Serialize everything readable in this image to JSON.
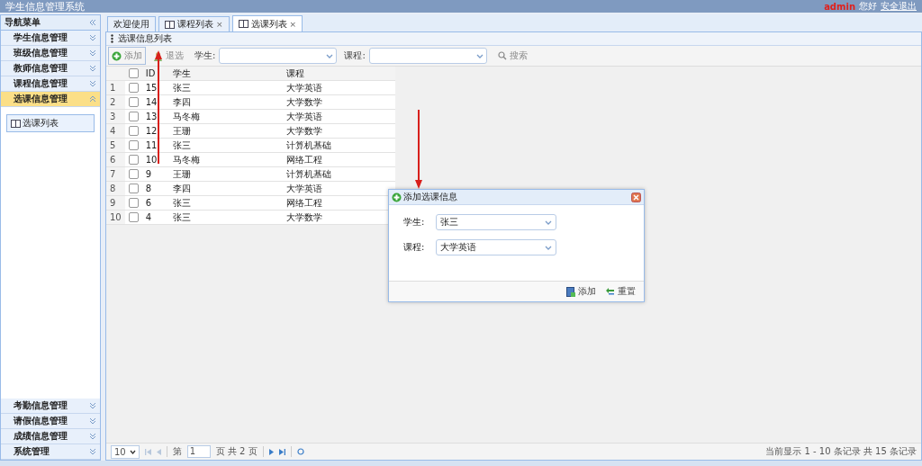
{
  "header": {
    "title": "学生信息管理系统",
    "user": "admin",
    "greeting": "您好",
    "logout": "安全退出"
  },
  "sidebar": {
    "title": "导航菜单",
    "items": [
      {
        "label": "学生信息管理",
        "selected": false,
        "expanded": false
      },
      {
        "label": "班级信息管理",
        "selected": false,
        "expanded": false
      },
      {
        "label": "教师信息管理",
        "selected": false,
        "expanded": false
      },
      {
        "label": "课程信息管理",
        "selected": false,
        "expanded": false
      },
      {
        "label": "选课信息管理",
        "selected": true,
        "expanded": true,
        "children": [
          {
            "label": "选课列表"
          }
        ]
      }
    ],
    "bottom_items": [
      {
        "label": "考勤信息管理",
        "selected": false,
        "expanded": false
      },
      {
        "label": "请假信息管理",
        "selected": false,
        "expanded": false
      },
      {
        "label": "成绩信息管理",
        "selected": false,
        "expanded": false
      },
      {
        "label": "系统管理",
        "selected": false,
        "expanded": false
      }
    ]
  },
  "tabs": [
    {
      "label": "欢迎使用",
      "selected": false,
      "kind": "plain"
    },
    {
      "label": "课程列表",
      "selected": false,
      "kind": "closable",
      "close": "×"
    },
    {
      "label": "选课列表",
      "selected": true,
      "kind": "closable",
      "close": "×"
    }
  ],
  "panel": {
    "title": "选课信息列表"
  },
  "toolbar": [
    {
      "label": "添加",
      "kind": "add"
    },
    {
      "label": "退选",
      "kind": "remove"
    }
  ],
  "filters": [
    {
      "label": "学生:"
    },
    {
      "label": "课程:"
    }
  ],
  "search": {
    "label": "搜索"
  },
  "table": {
    "select_all_checked": false,
    "columns": [
      "ID",
      "学生",
      "课程"
    ],
    "rows": [
      {
        "num": "1",
        "checked": false,
        "id": "15",
        "student": "张三",
        "course": "大学英语"
      },
      {
        "num": "2",
        "checked": false,
        "id": "14",
        "student": "李四",
        "course": "大学数学"
      },
      {
        "num": "3",
        "checked": false,
        "id": "13",
        "student": "马冬梅",
        "course": "大学英语"
      },
      {
        "num": "4",
        "checked": false,
        "id": "12",
        "student": "王珊",
        "course": "大学数学"
      },
      {
        "num": "5",
        "checked": false,
        "id": "11",
        "student": "张三",
        "course": "计算机基础"
      },
      {
        "num": "6",
        "checked": false,
        "id": "10",
        "student": "马冬梅",
        "course": "网络工程"
      },
      {
        "num": "7",
        "checked": false,
        "id": "9",
        "student": "王珊",
        "course": "计算机基础"
      },
      {
        "num": "8",
        "checked": false,
        "id": "8",
        "student": "李四",
        "course": "大学英语"
      },
      {
        "num": "9",
        "checked": false,
        "id": "6",
        "student": "张三",
        "course": "网络工程"
      },
      {
        "num": "10",
        "checked": false,
        "id": "4",
        "student": "张三",
        "course": "大学数学"
      }
    ]
  },
  "pager": {
    "page_size": "10",
    "before": "第",
    "page": "1",
    "after": "页 共 2 页",
    "info": "当前显示 1 - 10 条记录 共 15 条记录"
  },
  "dialog": {
    "title": "添加选课信息",
    "fields": [
      {
        "label": "学生:",
        "value": "张三"
      },
      {
        "label": "课程:",
        "value": "大学英语"
      }
    ],
    "buttons": [
      {
        "label": "添加",
        "kind": "save"
      },
      {
        "label": "重置",
        "kind": "reset"
      }
    ]
  }
}
